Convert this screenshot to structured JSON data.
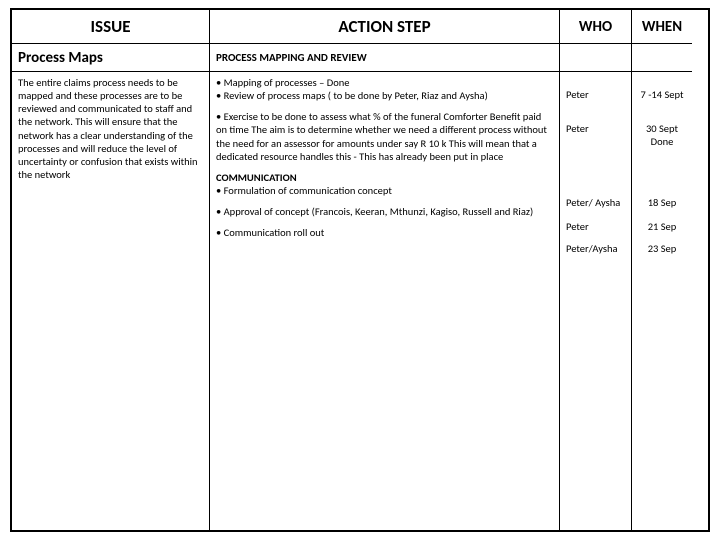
{
  "headers": {
    "issue": "ISSUE",
    "action": "ACTION STEP",
    "who": "WHO",
    "when": "WHEN"
  },
  "subheads": {
    "issue": "Process Maps",
    "action": "PROCESS MAPPING AND REVIEW"
  },
  "issue_body": "The entire claims process needs to be mapped and these processes are to be reviewed and communicated to staff and the network. This will ensure that the network has a clear understanding of the processes and will reduce the level of uncertainty or confusion that exists within the network",
  "actions": {
    "a1": "• Mapping of processes – Done",
    "a2": "• Review of process maps ( to be done by Peter, Riaz and Aysha)",
    "a3": "• Exercise to be done to assess what % of the funeral Comforter Benefit paid on time The aim is to determine whether we need a different process without the need for an assessor  for amounts under say R 10 k  This will mean that a dedicated resource handles this - This has already been put in place",
    "comm_head": "COMMUNICATION",
    "a4": "• Formulation of communication concept",
    "a5": "• Approval of concept (Francois, Keeran, Mthunzi, Kagiso, Russell and Riaz)",
    "a6": "• Communication roll out"
  },
  "who": {
    "w1": "",
    "w2": "Peter",
    "w3": "Peter",
    "w4": "Peter/ Aysha",
    "w5": "Peter",
    "w6": "Peter/Aysha"
  },
  "when": {
    "t1": "",
    "t2": "7 -14 Sept",
    "t3": "30 Sept Done",
    "t4": "18 Sep",
    "t5": "21 Sep",
    "t6": "23 Sep"
  }
}
